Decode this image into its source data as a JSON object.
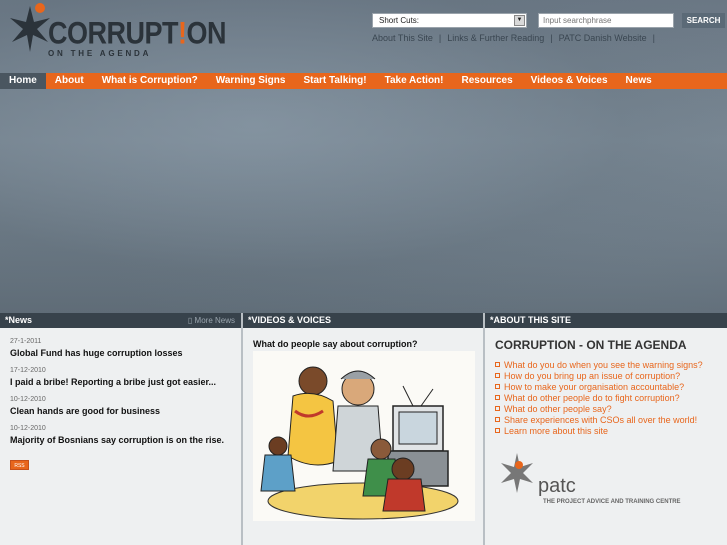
{
  "header": {
    "logo_main": "CORRUPT",
    "logo_bang": "!",
    "logo_end": "ON",
    "logo_sub": "ON THE AGENDA",
    "shortcuts_label": "Short Cuts:",
    "search_placeholder": "Input searchphrase",
    "search_button": "SEARCH",
    "top_links": [
      "About This Site",
      "Links & Further Reading",
      "PATC Danish Website"
    ]
  },
  "nav": {
    "items": [
      "Home",
      "About",
      "What is Corruption?",
      "Warning Signs",
      "Start Talking!",
      "Take Action!",
      "Resources",
      "Videos & Voices",
      "News"
    ]
  },
  "news": {
    "heading": "*News",
    "more": "More News",
    "items": [
      {
        "date": "27-1-2011",
        "title": "Global Fund has huge corruption losses"
      },
      {
        "date": "17-12-2010",
        "title": "I paid a bribe! Reporting a bribe just got easier..."
      },
      {
        "date": "10-12-2010",
        "title": "Clean hands are good for business"
      },
      {
        "date": "10-12-2010",
        "title": "Majority of Bosnians say corruption is on the rise."
      }
    ],
    "rss": "RSS"
  },
  "videos": {
    "heading": "*VIDEOS & VOICES",
    "question": "What do people say about corruption?"
  },
  "about": {
    "heading": "*ABOUT THIS SITE",
    "title": "CORRUPTION - ON THE AGENDA",
    "links": [
      "What do you do when you see the warning signs?",
      "How do you bring up an issue of corruption?",
      "How to make your organisation accountable?",
      "What do other people do to fight corruption?",
      "What do other people say?",
      "Share experiences with CSOs all over the world!",
      "Learn more about this site"
    ],
    "patc_name": "patc",
    "patc_full": "THE PROJECT ADVICE AND TRAINING CENTRE"
  },
  "colors": {
    "accent": "#e8661c",
    "dark": "#37424b"
  }
}
